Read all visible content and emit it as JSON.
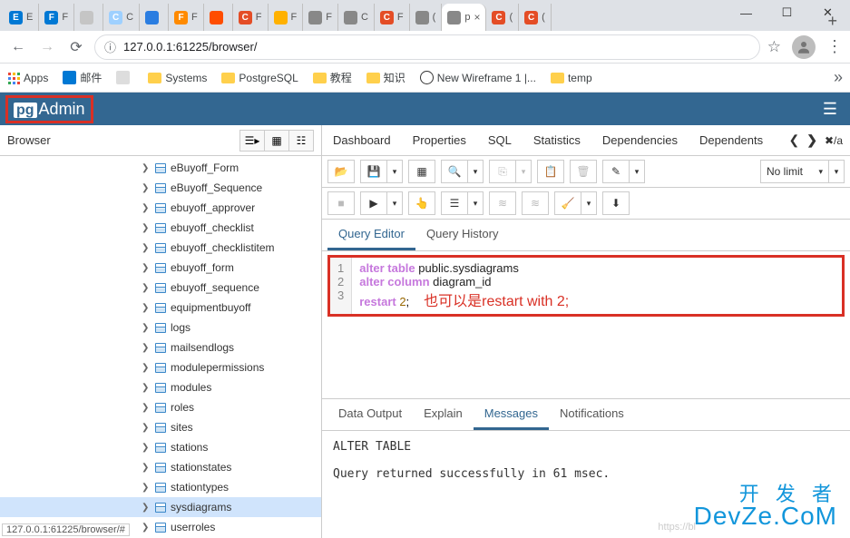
{
  "window": {
    "min": "—",
    "max": "☐",
    "close": "✕"
  },
  "browser": {
    "tabs": [
      {
        "color": "#0078d4",
        "label": "E",
        "text": "E"
      },
      {
        "color": "#0078d4",
        "label": "F",
        "text": "F"
      },
      {
        "color": "#c5c5c5",
        "label": "",
        "text": ""
      },
      {
        "color": "#9ed0ff",
        "label": "C",
        "text": "C"
      },
      {
        "color": "#2a7de1",
        "label": "",
        "text": ""
      },
      {
        "color": "#ff8a00",
        "label": "F",
        "text": "F"
      },
      {
        "color": "#ff4d00",
        "label": "",
        "text": ""
      },
      {
        "color": "#e44d26",
        "label": "C",
        "text": "F"
      },
      {
        "color": "#ffb100",
        "label": "",
        "text": "F"
      },
      {
        "color": "#888",
        "label": "",
        "text": "F"
      },
      {
        "color": "#888",
        "label": "",
        "text": "C"
      },
      {
        "color": "#e44d26",
        "label": "C",
        "text": "F"
      },
      {
        "color": "#888",
        "label": "",
        "text": "("
      },
      {
        "color": "#888",
        "label": "",
        "text": "p",
        "active": true,
        "close": "×"
      },
      {
        "color": "#e44d26",
        "label": "C",
        "text": "("
      },
      {
        "color": "#e44d26",
        "label": "C",
        "text": "("
      }
    ],
    "newtab": "+",
    "back": "←",
    "fwd": "→",
    "reload": "⟳",
    "url_icon": "ⓘ",
    "url": "127.0.0.1:61225/browser/",
    "star": "☆",
    "dots": "⋮"
  },
  "bookmarks": {
    "apps": "Apps",
    "items": [
      {
        "type": "outlook",
        "label": "邮件"
      },
      {
        "type": "blank",
        "label": ""
      },
      {
        "type": "folder",
        "label": "Systems"
      },
      {
        "type": "folder",
        "label": "PostgreSQL"
      },
      {
        "type": "folder",
        "label": "教程"
      },
      {
        "type": "folder",
        "label": "知识"
      },
      {
        "type": "smile",
        "label": "New Wireframe 1 |..."
      },
      {
        "type": "folder",
        "label": "temp"
      }
    ],
    "more": "»"
  },
  "pg": {
    "logo_prefix": "pg",
    "logo_text": "Admin",
    "hamburger": "☰"
  },
  "sidebar": {
    "title": "Browser",
    "tree": [
      "eBuyoff_Form",
      "eBuyoff_Sequence",
      "ebuyoff_approver",
      "ebuyoff_checklist",
      "ebuyoff_checklistitem",
      "ebuyoff_form",
      "ebuyoff_sequence",
      "equipmentbuyoff",
      "logs",
      "mailsendlogs",
      "modulepermissions",
      "modules",
      "roles",
      "sites",
      "stations",
      "stationstates",
      "stationtypes",
      "sysdiagrams",
      "userroles"
    ],
    "selected_index": 17,
    "status": "127.0.0.1:61225/browser/#"
  },
  "right_tabs": [
    "Dashboard",
    "Properties",
    "SQL",
    "Statistics",
    "Dependencies",
    "Dependents"
  ],
  "right_tabs_extra": "✖/a",
  "toolbar": {
    "row1": {
      "limit": "No limit"
    },
    "row2": {}
  },
  "sub_tabs": [
    "Query Editor",
    "Query History"
  ],
  "sub_tab_active": 0,
  "editor": {
    "lines": [
      "1",
      "2",
      "3"
    ],
    "l1a": "alter table ",
    "l1b": "public",
    "l1c": ".sysdiagrams",
    "l2a": "alter column ",
    "l2b": "diagram_id",
    "l3a": "restart ",
    "l3b": "2",
    "l3c": ";",
    "annotation": "也可以是restart with 2;"
  },
  "result_tabs": [
    "Data Output",
    "Explain",
    "Messages",
    "Notifications"
  ],
  "result_tab_active": 2,
  "messages": "ALTER TABLE\n\nQuery returned successfully in 61 msec.",
  "watermark": {
    "cn": "开 发 者",
    "en": "DevZe.CoM",
    "url": "https://bl"
  }
}
